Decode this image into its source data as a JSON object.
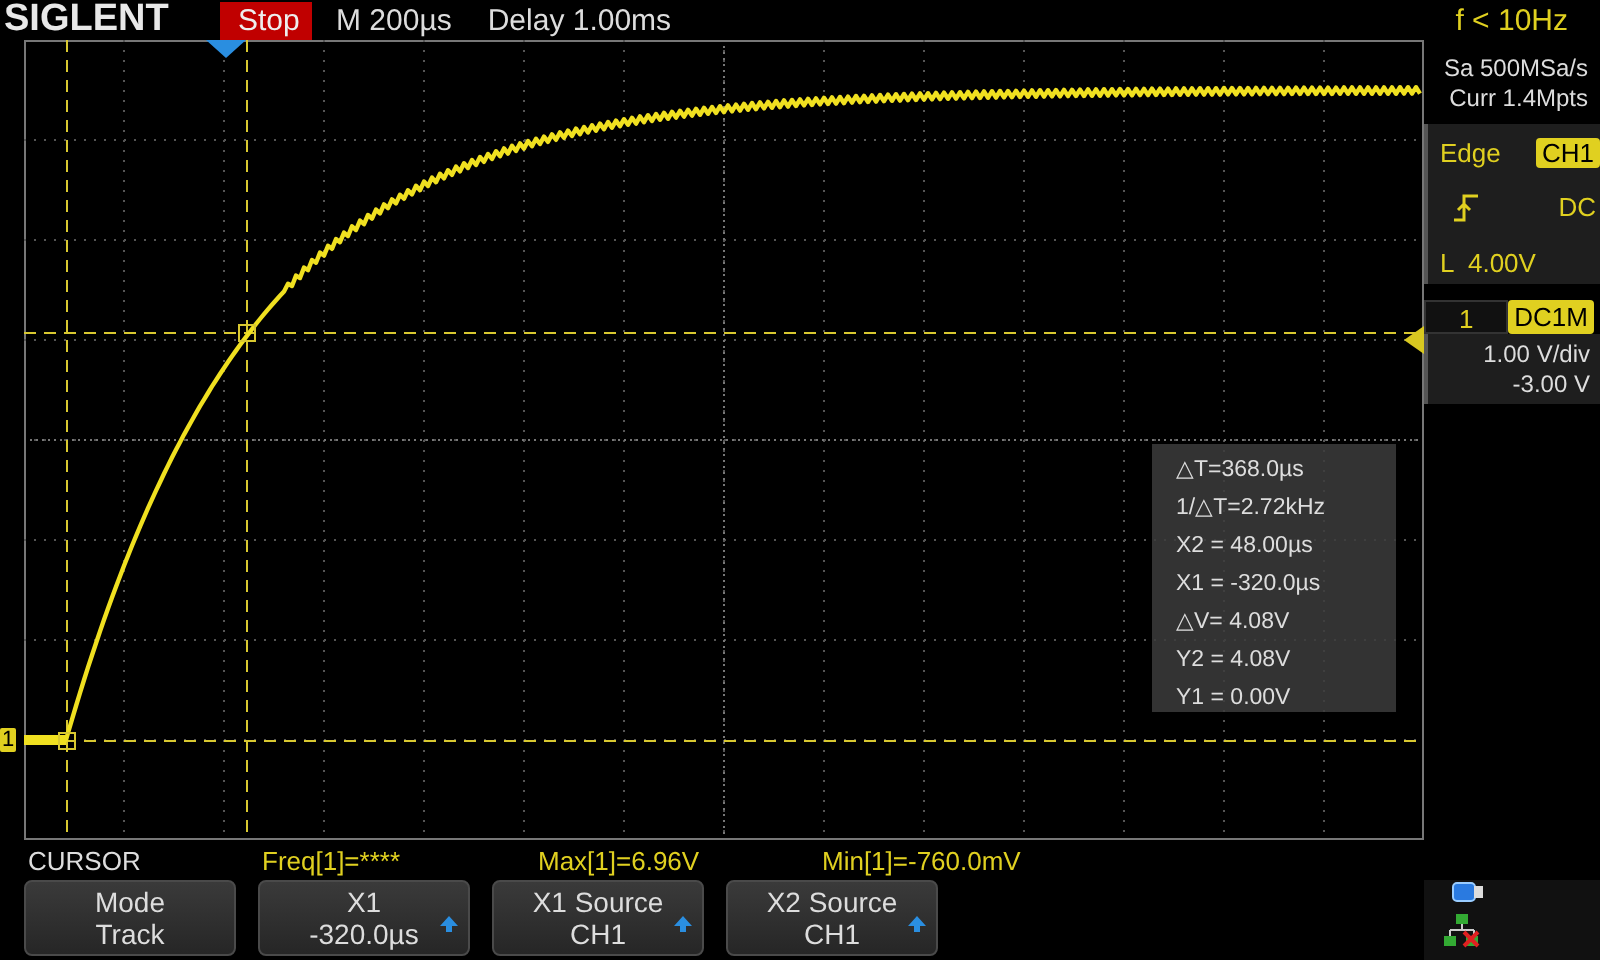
{
  "brand": "SIGLENT",
  "run_state": {
    "label": "Stop",
    "running": false
  },
  "timebase": "M 200µs",
  "delay": "Delay 1.00ms",
  "trigger_frequency": "f < 10Hz",
  "acquisition": {
    "sample_rate": "Sa 500MSa/s",
    "memory": "Curr 1.4Mpts"
  },
  "trigger": {
    "type": "Edge",
    "source": "CH1",
    "coupling": "DC",
    "level": "L  4.00V"
  },
  "channel": {
    "number": "1",
    "coupling": "DC1M",
    "scale": "1.00 V/div",
    "offset": "-3.00 V"
  },
  "ground_marker": "1",
  "cursor_readout": [
    "△T=368.0µs",
    "1/△T=2.72kHz",
    "X2 = 48.00µs",
    "X1 = -320.0µs",
    "△V= 4.08V",
    "Y2 = 4.08V",
    "Y1 = 0.00V"
  ],
  "measurements": {
    "title": "CURSOR",
    "items": [
      "Freq[1]=****",
      "Max[1]=6.96V",
      "Min[1]=-760.0mV"
    ]
  },
  "softkeys": [
    {
      "label": "Mode",
      "value": "Track",
      "arrow": false
    },
    {
      "label": "X1",
      "value": "-320.0µs",
      "arrow": true
    },
    {
      "label": "X1 Source",
      "value": "CH1",
      "arrow": true
    },
    {
      "label": "X2 Source",
      "value": "CH1",
      "arrow": true
    }
  ]
}
